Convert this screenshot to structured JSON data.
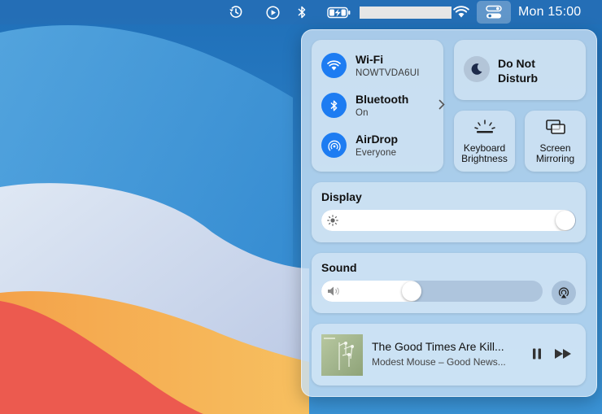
{
  "menubar": {
    "icons": [
      "time-machine-icon",
      "play-icon",
      "bluetooth-icon",
      "battery-charging-icon",
      "wifi-icon",
      "control-center-icon"
    ],
    "clock": "Mon 15:00"
  },
  "control_center": {
    "wifi": {
      "title": "Wi-Fi",
      "subtitle": "NOWTVDA6UI"
    },
    "bluetooth": {
      "title": "Bluetooth",
      "subtitle": "On"
    },
    "airdrop": {
      "title": "AirDrop",
      "subtitle": "Everyone"
    },
    "dnd": {
      "line1": "Do Not",
      "line2": "Disturb"
    },
    "keyboard": {
      "line1": "Keyboard",
      "line2": "Brightness"
    },
    "screen_mirroring": {
      "line1": "Screen",
      "line2": "Mirroring"
    },
    "display": {
      "title": "Display",
      "level": 1.0
    },
    "sound": {
      "title": "Sound",
      "level": 0.4
    },
    "now_playing": {
      "title": "The Good Times Are Kill...",
      "artist": "Modest Mouse – Good News..."
    }
  },
  "colors": {
    "accent": "#1d7cf2"
  }
}
